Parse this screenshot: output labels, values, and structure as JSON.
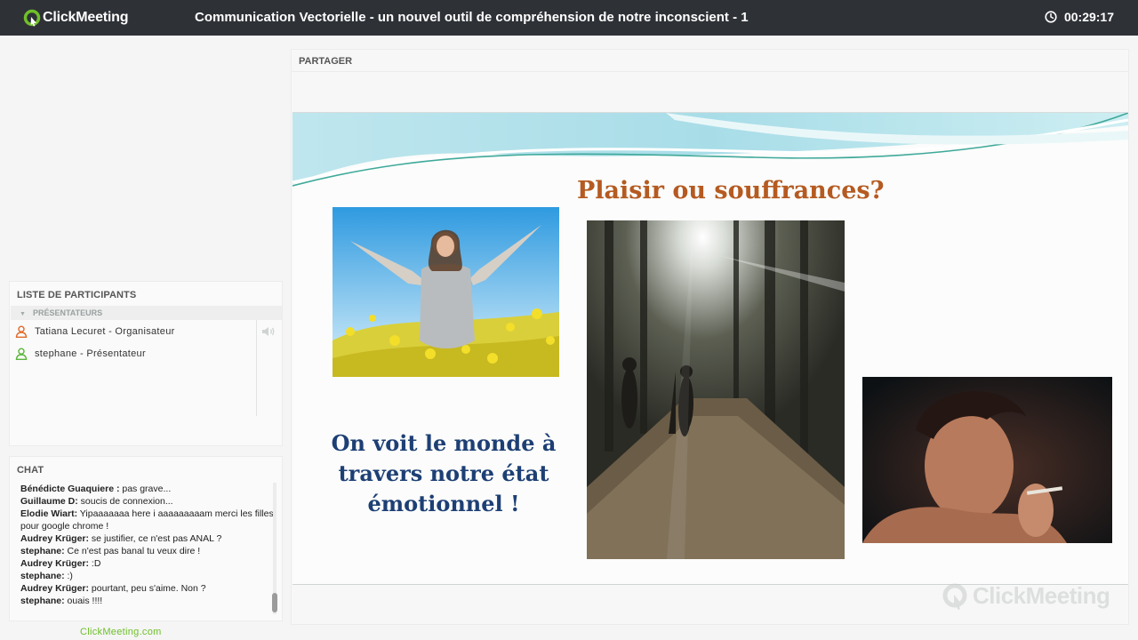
{
  "app": {
    "brand": "ClickMeeting",
    "accent_color": "#6fbf2a",
    "topbar_color": "#2e3136"
  },
  "header": {
    "title": "Communication Vectorielle - un nouvel outil de compréhension de notre inconscient - 1",
    "timer": "00:29:17"
  },
  "participants": {
    "heading": "LISTE DE PARTICIPANTS",
    "section": "PRÉSENTATEURS",
    "items": [
      {
        "name": "Tatiana Lecuret - Organisateur",
        "icon": "user-icon-organizer",
        "color": "#e06a2c"
      },
      {
        "name": "stephane - Présentateur",
        "icon": "user-icon-presenter",
        "color": "#5bb53a"
      }
    ]
  },
  "chat": {
    "heading": "CHAT",
    "messages": [
      {
        "author": "Bénédicte  Guaquiere :",
        "text": " pas grave..."
      },
      {
        "author": "Guillaume D:",
        "text": " soucis de connexion..."
      },
      {
        "author": "Elodie Wiart:",
        "text": " Yipaaaaaaa here i aaaaaaaaam merci les filles pour google chrome !"
      },
      {
        "author": "Audrey Krüger:",
        "text": " se justifier, ce n'est pas ANAL ?"
      },
      {
        "author": "stephane:",
        "text": " Ce n'est pas banal tu veux dire !"
      },
      {
        "author": "Audrey Krüger:",
        "text": " :D"
      },
      {
        "author": "stephane:",
        "text": " :)"
      },
      {
        "author": "Audrey Krüger:",
        "text": " pourtant, peu s'aime. Non ?"
      },
      {
        "author": "stephane:",
        "text": " ouais !!!!"
      }
    ]
  },
  "footer": {
    "link": "ClickMeeting.com"
  },
  "share": {
    "heading": "PARTAGER",
    "slide": {
      "title": "Plaisir ou souffrances?",
      "text": "On voit le monde à travers notre état émotionnel !",
      "title_color": "#b55a21",
      "text_color": "#1d3f74"
    },
    "watermark": "ClickMeeting"
  }
}
